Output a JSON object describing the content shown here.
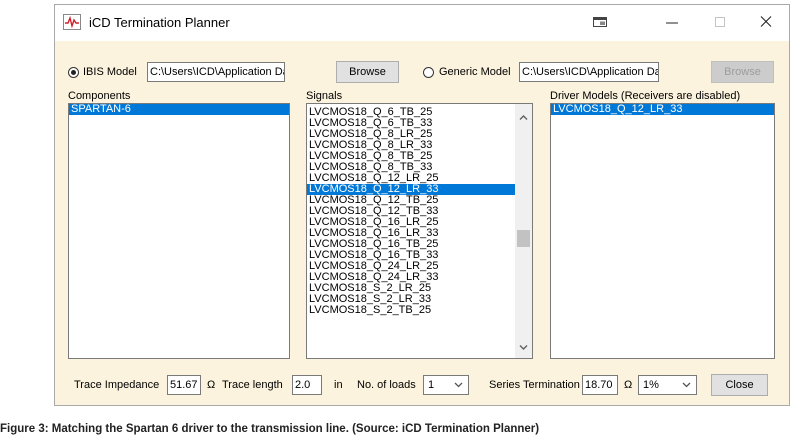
{
  "window": {
    "title": "iCD Termination Planner",
    "accent_color": "#0078d7"
  },
  "model_select": {
    "ibis_label": "IBIS Model",
    "ibis_selected": true,
    "ibis_path": "C:\\Users\\ICD\\Application Data\\ICD",
    "browse_label": "Browse",
    "generic_label": "Generic Model",
    "generic_selected": false,
    "generic_path": "C:\\Users\\ICD\\Application Data\\ICD",
    "generic_browse_label": "Browse"
  },
  "components": {
    "header": "Components",
    "items": [
      "SPARTAN-6"
    ],
    "selected": "SPARTAN-6"
  },
  "signals": {
    "header": "Signals",
    "items": [
      "LVCMOS18_Q_6_TB_25",
      "LVCMOS18_Q_6_TB_33",
      "LVCMOS18_Q_8_LR_25",
      "LVCMOS18_Q_8_LR_33",
      "LVCMOS18_Q_8_TB_25",
      "LVCMOS18_Q_8_TB_33",
      "LVCMOS18_Q_12_LR_25",
      "LVCMOS18_Q_12_LR_33",
      "LVCMOS18_Q_12_TB_25",
      "LVCMOS18_Q_12_TB_33",
      "LVCMOS18_Q_16_LR_25",
      "LVCMOS18_Q_16_LR_33",
      "LVCMOS18_Q_16_TB_25",
      "LVCMOS18_Q_16_TB_33",
      "LVCMOS18_Q_24_LR_25",
      "LVCMOS18_Q_24_LR_33",
      "LVCMOS18_S_2_LR_25",
      "LVCMOS18_S_2_LR_33",
      "LVCMOS18_S_2_TB_25"
    ],
    "selected_index": 7
  },
  "drivers": {
    "header": "Driver Models (Receivers are disabled)",
    "items": [
      "LVCMOS18_Q_12_LR_33"
    ],
    "selected": "LVCMOS18_Q_12_LR_33"
  },
  "bottom": {
    "trace_impedance_label": "Trace Impedance",
    "trace_impedance_value": "51.67",
    "ohm": "Ω",
    "trace_length_label": "Trace length",
    "trace_length_value": "2.0",
    "trace_length_unit": "in",
    "loads_label": "No. of loads",
    "loads_value": "1",
    "series_label": "Series Termination",
    "series_value": "18.70",
    "series_ohm": "Ω",
    "tolerance_value": "1%",
    "close_label": "Close"
  },
  "caption": "Figure 3: Matching the Spartan 6 driver to the transmission line. (Source: iCD Termination Planner)"
}
